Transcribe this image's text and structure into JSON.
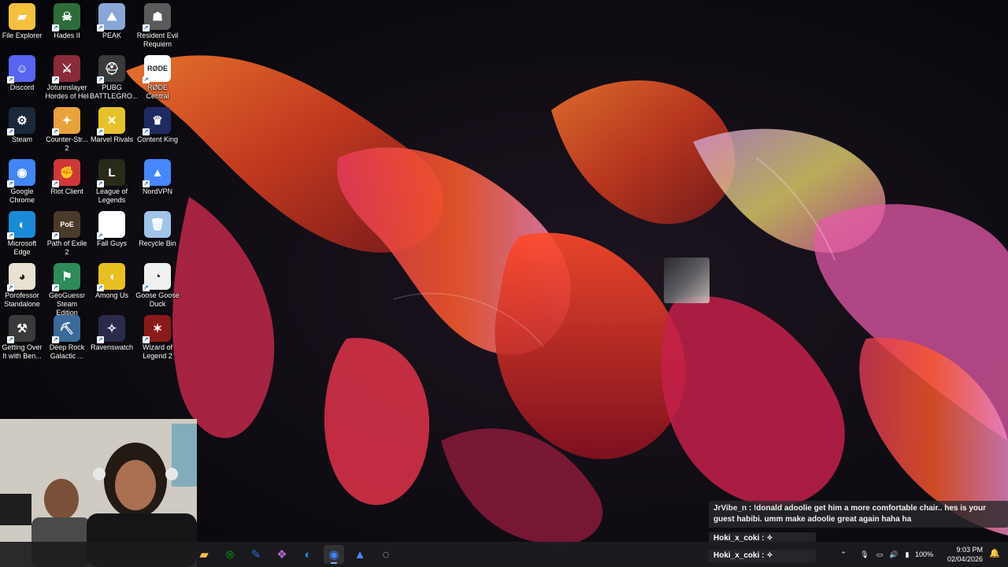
{
  "desktop": {
    "icons": [
      {
        "label": "File Explorer",
        "icon": "folder-icon",
        "color": "#f4c13d",
        "glyph": "▰"
      },
      {
        "label": "Hades II",
        "icon": "hades-icon",
        "color": "#2e6b3a",
        "glyph": "☠"
      },
      {
        "label": "PEAK",
        "icon": "peak-icon",
        "color": "#8aa6d6",
        "glyph": "⛰"
      },
      {
        "label": "Resident Evil Requiem",
        "icon": "resident-evil-icon",
        "color": "#5a5a5a",
        "glyph": "☗"
      },
      {
        "label": "Discord",
        "icon": "discord-icon",
        "color": "#5865f2",
        "glyph": "☺"
      },
      {
        "label": "Jotunnslayer Hordes of Hel",
        "icon": "jotunnslayer-icon",
        "color": "#8a2a3a",
        "glyph": "⚔"
      },
      {
        "label": "PUBG BATTLEGRO...",
        "icon": "pubg-icon",
        "color": "#3a3a3a",
        "glyph": "⛑"
      },
      {
        "label": "RØDE Central",
        "icon": "rode-icon",
        "color": "#ffffff",
        "glyph": "RØDE"
      },
      {
        "label": "Steam",
        "icon": "steam-icon",
        "color": "#1b2838",
        "glyph": "⚙"
      },
      {
        "label": "Counter-Str... 2",
        "icon": "counter-strike-icon",
        "color": "#e8a33a",
        "glyph": "✦"
      },
      {
        "label": "Marvel Rivals",
        "icon": "marvel-rivals-icon",
        "color": "#e6c32a",
        "glyph": "✕"
      },
      {
        "label": "Content King",
        "icon": "content-king-icon",
        "color": "#1f2a60",
        "glyph": "♛"
      },
      {
        "label": "Google Chrome",
        "icon": "chrome-icon",
        "color": "#4285f4",
        "glyph": "◉"
      },
      {
        "label": "Riot Client",
        "icon": "riot-icon",
        "color": "#d13639",
        "glyph": "✊"
      },
      {
        "label": "League of Legends",
        "icon": "league-icon",
        "color": "#2a2a1a",
        "glyph": "L"
      },
      {
        "label": "NordVPN",
        "icon": "nordvpn-icon",
        "color": "#4687ff",
        "glyph": "▲"
      },
      {
        "label": "Microsoft Edge",
        "icon": "edge-icon",
        "color": "#1b8ad6",
        "glyph": "◐"
      },
      {
        "label": "Path of Exile 2",
        "icon": "path-of-exile-icon",
        "color": "#4a3a2a",
        "glyph": "PoE"
      },
      {
        "label": "Fall Guys",
        "icon": "fall-guys-icon",
        "color": "#ffffff",
        "glyph": ""
      },
      {
        "label": "Recycle Bin",
        "icon": "recycle-bin-icon",
        "color": "#9fc4e8",
        "glyph": "🗑"
      },
      {
        "label": "Porofessor Standalone",
        "icon": "porofessor-icon",
        "color": "#e8e0d0",
        "glyph": "◕"
      },
      {
        "label": "GeoGuessr Steam Edition",
        "icon": "geoguessr-icon",
        "color": "#2e8b57",
        "glyph": "⚑"
      },
      {
        "label": "Among Us",
        "icon": "among-us-icon",
        "color": "#e8c020",
        "glyph": "◖"
      },
      {
        "label": "Goose Goose Duck",
        "icon": "goose-icon",
        "color": "#f0f0f0",
        "glyph": "◔"
      },
      {
        "label": "Getting Over It with Ben...",
        "icon": "getting-over-it-icon",
        "color": "#3a3a3a",
        "glyph": "⚒"
      },
      {
        "label": "Deep Rock Galactic ...",
        "icon": "deep-rock-icon",
        "color": "#3a6a9a",
        "glyph": "⛏"
      },
      {
        "label": "Ravenswatch",
        "icon": "ravenswatch-icon",
        "color": "#2a2a4a",
        "glyph": "✧"
      },
      {
        "label": "Wizard of Legend 2",
        "icon": "wizard-of-legend-icon",
        "color": "#8a1a1a",
        "glyph": "✶"
      }
    ]
  },
  "chat": {
    "message1": {
      "user": "JrVibe_n",
      "text": "!donald adoolie get him a more comfortable chair.. hes is your guest habibi. umm make adoolie great again haha ha"
    },
    "message2": {
      "user": "Hoki_x_coki",
      "text": ""
    },
    "message3": {
      "user": "Hoki_x_coki",
      "text": ""
    },
    "separator": " : "
  },
  "taskbar": {
    "apps": [
      {
        "name": "file-explorer-taskbar",
        "icon": "folder-icon",
        "color": "#f4c13d",
        "glyph": "▰"
      },
      {
        "name": "xbox-taskbar",
        "icon": "xbox-icon",
        "color": "#107c10",
        "glyph": "⊗"
      },
      {
        "name": "editor-taskbar",
        "icon": "pen-icon",
        "color": "#2b6fd6",
        "glyph": "✎"
      },
      {
        "name": "copilot-taskbar",
        "icon": "copilot-icon",
        "color": "#b86ad6",
        "glyph": "❖"
      },
      {
        "name": "edge-taskbar",
        "icon": "edge-icon",
        "color": "#1b8ad6",
        "glyph": "◐"
      },
      {
        "name": "chrome-taskbar",
        "icon": "chrome-icon",
        "color": "#4285f4",
        "glyph": "◉",
        "active": true
      },
      {
        "name": "nordvpn-taskbar",
        "icon": "nordvpn-icon",
        "color": "#4687ff",
        "glyph": "▲"
      },
      {
        "name": "obs-taskbar",
        "icon": "obs-icon",
        "color": "#e0e0e0",
        "glyph": "◌"
      }
    ],
    "battery": "100%",
    "time": "9:03 PM",
    "date": "02/04/2026"
  }
}
